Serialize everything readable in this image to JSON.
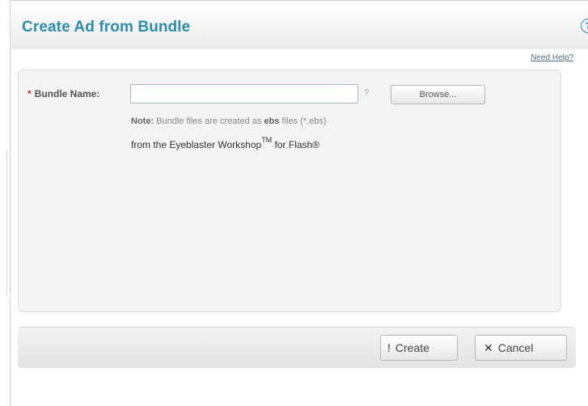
{
  "dialog": {
    "title": "Create Ad from Bundle",
    "help_glyph": "?",
    "need_help_link": "Need Help?"
  },
  "form": {
    "required_marker": "*",
    "bundle_name_label": "Bundle Name:",
    "bundle_name_value": "",
    "question_glyph": "?",
    "browse_label": "Browse...",
    "note_prefix": "Note:",
    "note_text_a": " Bundle files are created as ",
    "note_ext": "ebs",
    "note_text_b": " files (*.ebs)",
    "origin_text": "from the Eyeblaster Workshop",
    "origin_tm": "TM",
    "origin_suffix": " for Flash®"
  },
  "buttons": {
    "create_icon": "!",
    "create_label": "Create",
    "cancel_icon": "✕",
    "cancel_label": "Cancel"
  },
  "colors": {
    "title": "#2c8db0",
    "panel": "#f3f3f3",
    "required": "#c0392b"
  },
  "icons": [
    "help-circle-icon",
    "question-icon",
    "create-icon",
    "cancel-x-icon"
  ]
}
